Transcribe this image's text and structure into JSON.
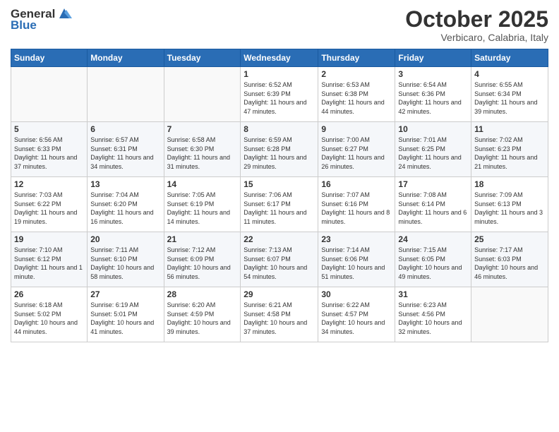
{
  "logo": {
    "general": "General",
    "blue": "Blue"
  },
  "header": {
    "month": "October 2025",
    "location": "Verbicaro, Calabria, Italy"
  },
  "weekdays": [
    "Sunday",
    "Monday",
    "Tuesday",
    "Wednesday",
    "Thursday",
    "Friday",
    "Saturday"
  ],
  "weeks": [
    [
      {
        "day": "",
        "info": ""
      },
      {
        "day": "",
        "info": ""
      },
      {
        "day": "",
        "info": ""
      },
      {
        "day": "1",
        "info": "Sunrise: 6:52 AM\nSunset: 6:39 PM\nDaylight: 11 hours\nand 47 minutes."
      },
      {
        "day": "2",
        "info": "Sunrise: 6:53 AM\nSunset: 6:38 PM\nDaylight: 11 hours\nand 44 minutes."
      },
      {
        "day": "3",
        "info": "Sunrise: 6:54 AM\nSunset: 6:36 PM\nDaylight: 11 hours\nand 42 minutes."
      },
      {
        "day": "4",
        "info": "Sunrise: 6:55 AM\nSunset: 6:34 PM\nDaylight: 11 hours\nand 39 minutes."
      }
    ],
    [
      {
        "day": "5",
        "info": "Sunrise: 6:56 AM\nSunset: 6:33 PM\nDaylight: 11 hours\nand 37 minutes."
      },
      {
        "day": "6",
        "info": "Sunrise: 6:57 AM\nSunset: 6:31 PM\nDaylight: 11 hours\nand 34 minutes."
      },
      {
        "day": "7",
        "info": "Sunrise: 6:58 AM\nSunset: 6:30 PM\nDaylight: 11 hours\nand 31 minutes."
      },
      {
        "day": "8",
        "info": "Sunrise: 6:59 AM\nSunset: 6:28 PM\nDaylight: 11 hours\nand 29 minutes."
      },
      {
        "day": "9",
        "info": "Sunrise: 7:00 AM\nSunset: 6:27 PM\nDaylight: 11 hours\nand 26 minutes."
      },
      {
        "day": "10",
        "info": "Sunrise: 7:01 AM\nSunset: 6:25 PM\nDaylight: 11 hours\nand 24 minutes."
      },
      {
        "day": "11",
        "info": "Sunrise: 7:02 AM\nSunset: 6:23 PM\nDaylight: 11 hours\nand 21 minutes."
      }
    ],
    [
      {
        "day": "12",
        "info": "Sunrise: 7:03 AM\nSunset: 6:22 PM\nDaylight: 11 hours\nand 19 minutes."
      },
      {
        "day": "13",
        "info": "Sunrise: 7:04 AM\nSunset: 6:20 PM\nDaylight: 11 hours\nand 16 minutes."
      },
      {
        "day": "14",
        "info": "Sunrise: 7:05 AM\nSunset: 6:19 PM\nDaylight: 11 hours\nand 14 minutes."
      },
      {
        "day": "15",
        "info": "Sunrise: 7:06 AM\nSunset: 6:17 PM\nDaylight: 11 hours\nand 11 minutes."
      },
      {
        "day": "16",
        "info": "Sunrise: 7:07 AM\nSunset: 6:16 PM\nDaylight: 11 hours\nand 8 minutes."
      },
      {
        "day": "17",
        "info": "Sunrise: 7:08 AM\nSunset: 6:14 PM\nDaylight: 11 hours\nand 6 minutes."
      },
      {
        "day": "18",
        "info": "Sunrise: 7:09 AM\nSunset: 6:13 PM\nDaylight: 11 hours\nand 3 minutes."
      }
    ],
    [
      {
        "day": "19",
        "info": "Sunrise: 7:10 AM\nSunset: 6:12 PM\nDaylight: 11 hours\nand 1 minute."
      },
      {
        "day": "20",
        "info": "Sunrise: 7:11 AM\nSunset: 6:10 PM\nDaylight: 10 hours\nand 58 minutes."
      },
      {
        "day": "21",
        "info": "Sunrise: 7:12 AM\nSunset: 6:09 PM\nDaylight: 10 hours\nand 56 minutes."
      },
      {
        "day": "22",
        "info": "Sunrise: 7:13 AM\nSunset: 6:07 PM\nDaylight: 10 hours\nand 54 minutes."
      },
      {
        "day": "23",
        "info": "Sunrise: 7:14 AM\nSunset: 6:06 PM\nDaylight: 10 hours\nand 51 minutes."
      },
      {
        "day": "24",
        "info": "Sunrise: 7:15 AM\nSunset: 6:05 PM\nDaylight: 10 hours\nand 49 minutes."
      },
      {
        "day": "25",
        "info": "Sunrise: 7:17 AM\nSunset: 6:03 PM\nDaylight: 10 hours\nand 46 minutes."
      }
    ],
    [
      {
        "day": "26",
        "info": "Sunrise: 6:18 AM\nSunset: 5:02 PM\nDaylight: 10 hours\nand 44 minutes."
      },
      {
        "day": "27",
        "info": "Sunrise: 6:19 AM\nSunset: 5:01 PM\nDaylight: 10 hours\nand 41 minutes."
      },
      {
        "day": "28",
        "info": "Sunrise: 6:20 AM\nSunset: 4:59 PM\nDaylight: 10 hours\nand 39 minutes."
      },
      {
        "day": "29",
        "info": "Sunrise: 6:21 AM\nSunset: 4:58 PM\nDaylight: 10 hours\nand 37 minutes."
      },
      {
        "day": "30",
        "info": "Sunrise: 6:22 AM\nSunset: 4:57 PM\nDaylight: 10 hours\nand 34 minutes."
      },
      {
        "day": "31",
        "info": "Sunrise: 6:23 AM\nSunset: 4:56 PM\nDaylight: 10 hours\nand 32 minutes."
      },
      {
        "day": "",
        "info": ""
      }
    ]
  ]
}
